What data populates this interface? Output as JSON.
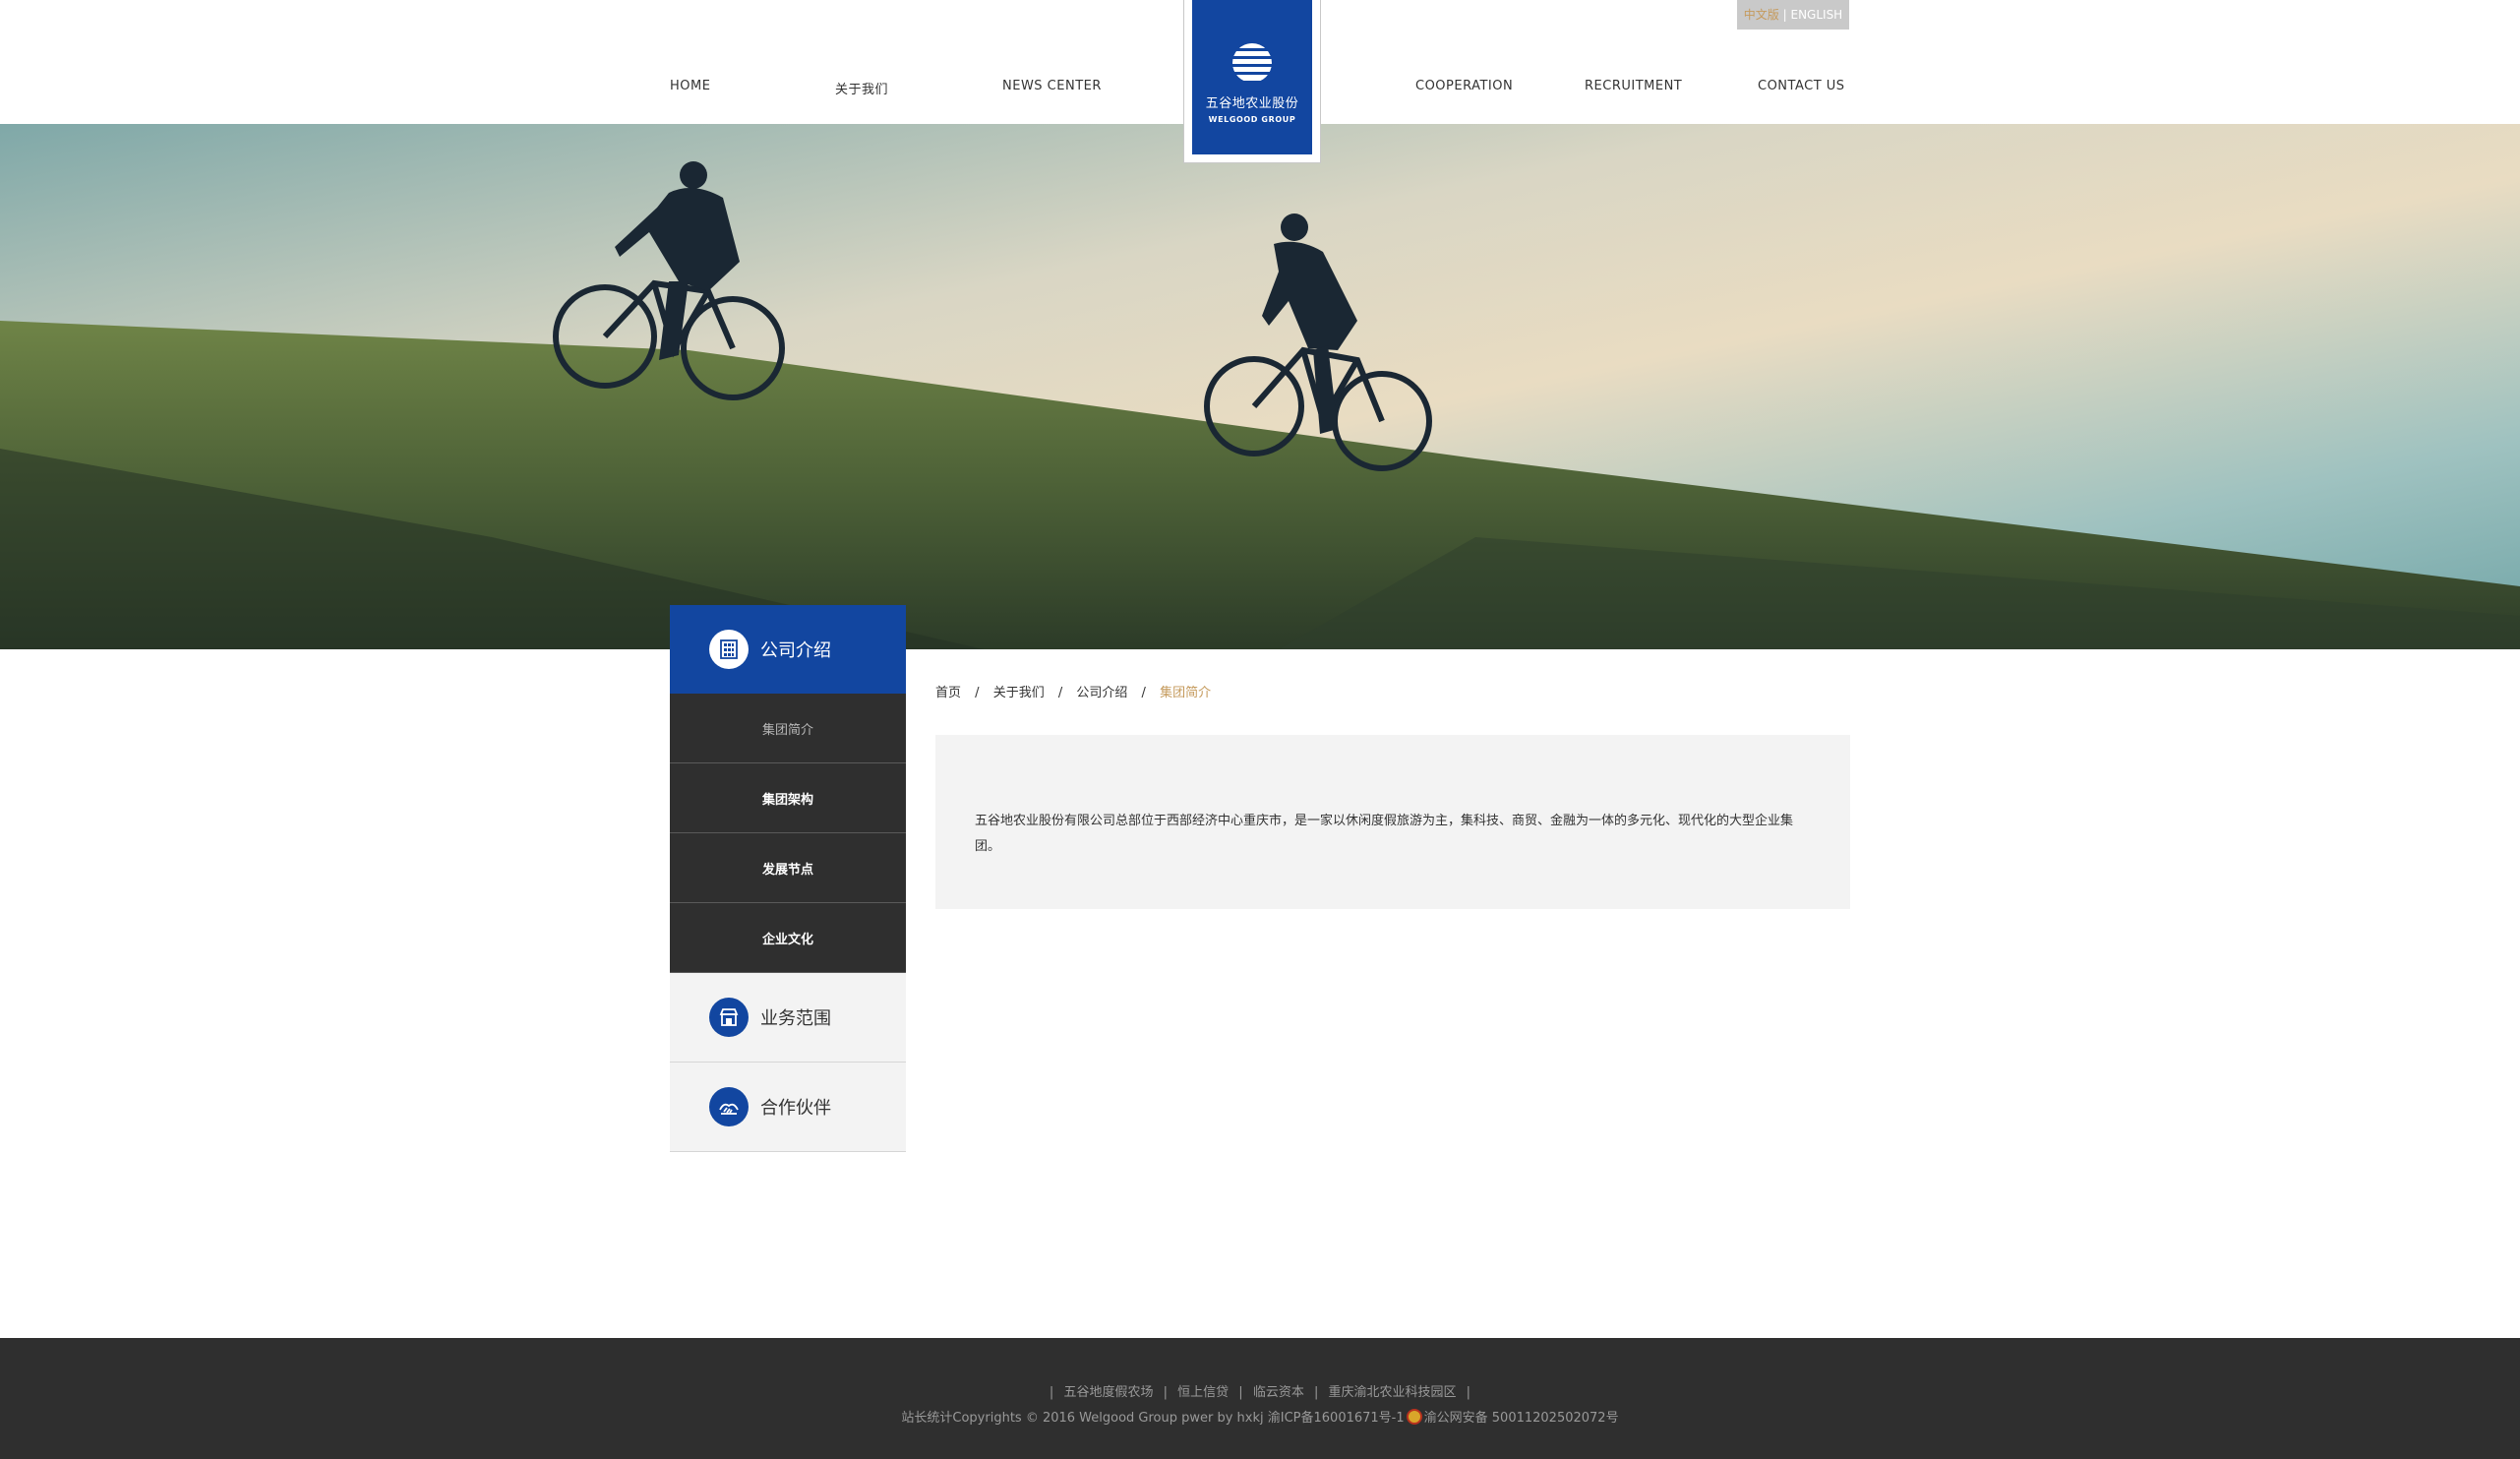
{
  "header": {
    "nav_left": [
      "HOME",
      "关于我们",
      "NEWS CENTER"
    ],
    "nav_right": [
      "COOPERATION",
      "RECRUITMENT",
      "CONTACT US"
    ],
    "lang_cn": "中文版",
    "lang_sep": "|",
    "lang_en": "ENGLISH",
    "logo_cn": "五谷地农业股份",
    "logo_en": "WELGOOD GROUP"
  },
  "sidebar": {
    "head_label": "公司介绍",
    "sub_items": [
      "集团简介",
      "集团架构",
      "发展节点",
      "企业文化"
    ],
    "active_sub": "集团简介",
    "categories": [
      "业务范围",
      "合作伙伴"
    ]
  },
  "breadcrumb": {
    "items": [
      "首页",
      "关于我们",
      "公司介绍"
    ],
    "current": "集团简介",
    "separator": "/"
  },
  "content": {
    "intro": "五谷地农业股份有限公司总部位于西部经济中心重庆市，是一家以休闲度假旅游为主，集科技、商贸、金融为一体的多元化、现代化的大型企业集团。"
  },
  "footer": {
    "links": [
      "五谷地度假农场",
      "恒上信贷",
      "临云资本",
      "重庆渝北农业科技园区"
    ],
    "link_bar": "|",
    "copy_left": "站长统计Copyrights © 2016 Welgood Group pwer by hxkj 渝ICP备16001671号-1",
    "copy_right": "渝公网安备 50011202502072号"
  },
  "colors": {
    "brand_blue": "#1246a0",
    "accent_gold": "#c59a5c",
    "dark_gray": "#2f2f2f",
    "light_gray": "#f3f3f3"
  },
  "icons": {
    "sidebar_head": "building-icon",
    "business_scope": "shop-icon",
    "partners": "handshake-icon",
    "footer_badge": "police-emblem-icon",
    "logo": "globe-lines-icon"
  }
}
